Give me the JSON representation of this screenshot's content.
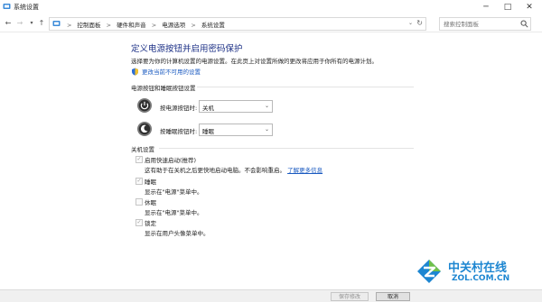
{
  "window": {
    "title": "系统设置",
    "controls": {
      "minimize": "─",
      "maximize": "□",
      "close": "✕"
    }
  },
  "nav": {
    "back": "←",
    "forward": "→",
    "recent": "▾",
    "up": "↑",
    "breadcrumbs": [
      "控制面板",
      "硬件和声音",
      "电源选项",
      "系统设置"
    ],
    "separator": ">",
    "address_dropdown": "⌄",
    "refresh": "↻",
    "search_placeholder": "搜索控制面板"
  },
  "main": {
    "title": "定义电源按钮并启用密码保护",
    "description": "选择要为你的计算机设置的电源设置。在此页上对设置所做的更改将应用于你所有的电源计划。",
    "change_link": "更改当前不可用的设置",
    "power_section": {
      "heading": "电源按钮和睡眠按钮设置",
      "rows": [
        {
          "label": "按电源按钮时:",
          "value": "关机"
        },
        {
          "label": "按睡眠按钮时:",
          "value": "睡眠"
        }
      ]
    },
    "shutdown_section": {
      "heading": "关机设置",
      "options": [
        {
          "label": "启用快速启动(推荐)",
          "desc": "这有助于在关机之后更快地启动电脑。不会影响重启。",
          "link": "了解更多信息",
          "checked": true
        },
        {
          "label": "睡眠",
          "desc": "显示在\"电源\"菜单中。",
          "checked": true
        },
        {
          "label": "休眠",
          "desc": "显示在\"电源\"菜单中。",
          "checked": false
        },
        {
          "label": "锁定",
          "desc": "显示在用户头像菜单中。",
          "checked": true
        }
      ]
    }
  },
  "footer": {
    "save": "保存修改",
    "cancel": "取消"
  },
  "watermark": {
    "name": "中关村在线",
    "domain": "ZOL.COM.CN"
  },
  "colors": {
    "title_blue": "#1e3287",
    "link_blue": "#1a5ac0",
    "brand_blue": "#1d86d1"
  }
}
